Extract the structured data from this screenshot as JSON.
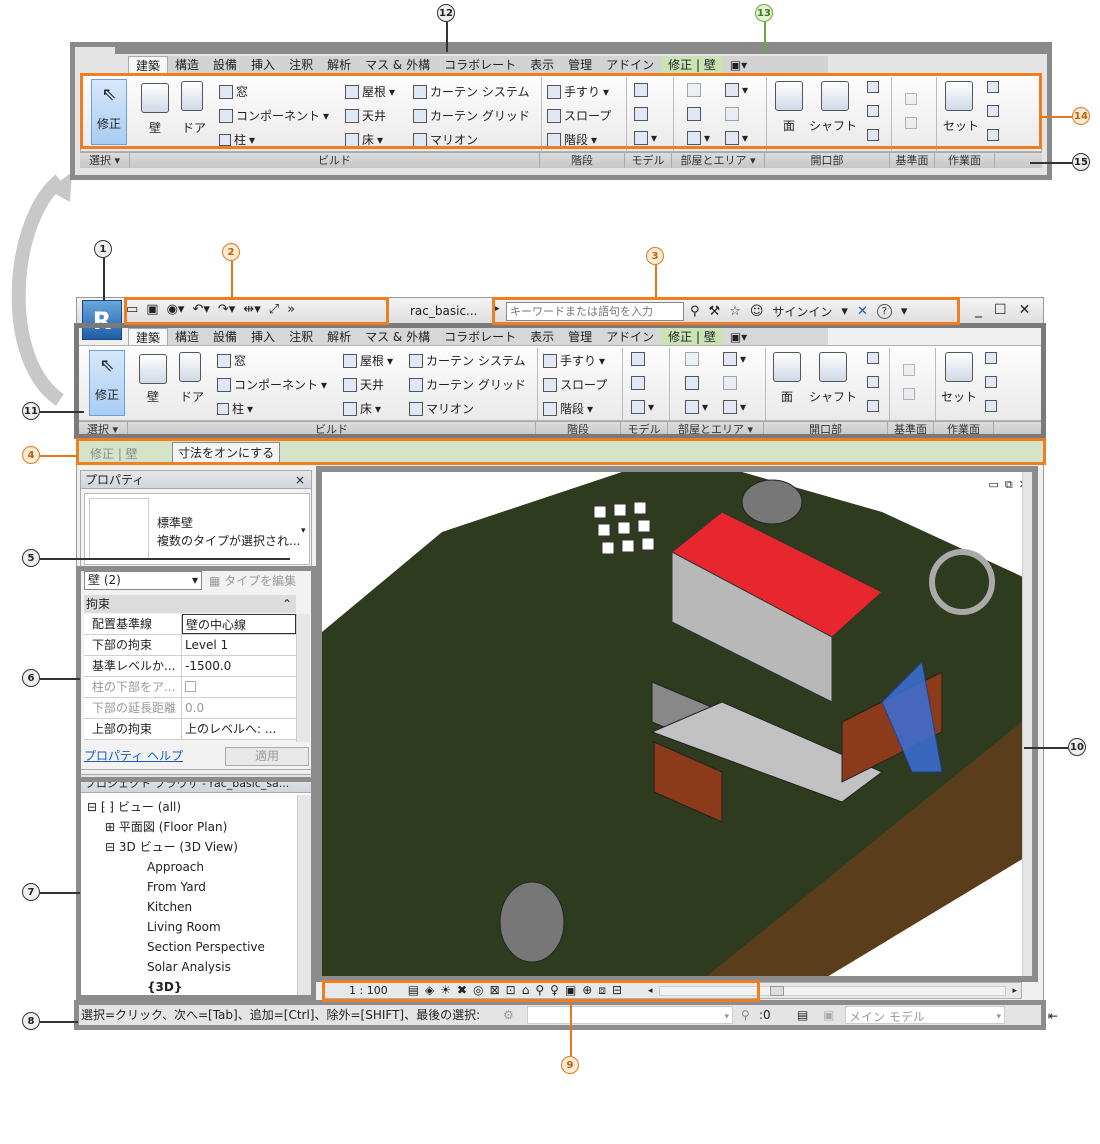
{
  "callouts": [
    "1",
    "2",
    "3",
    "4",
    "5",
    "6",
    "7",
    "8",
    "9",
    "10",
    "11",
    "12",
    "13",
    "14",
    "15"
  ],
  "tabs": [
    "建築",
    "構造",
    "設備",
    "挿入",
    "注釈",
    "解析",
    "マス & 外構",
    "コラボレート",
    "表示",
    "管理",
    "アドイン",
    "修正 | 壁",
    "▣▾"
  ],
  "ribbon": {
    "select": "修正",
    "wall": "壁",
    "door": "ドア",
    "window": "窓",
    "component": "コンポーネント",
    "column": "柱",
    "roof": "屋根",
    "ceiling": "天井",
    "floor": "床",
    "curtain_system": "カーテン システム",
    "curtain_grid": "カーテン グリッド",
    "mullion": "マリオン",
    "railing": "手すり",
    "ramp": "スロープ",
    "stair": "階段",
    "face": "面",
    "shaft": "シャフト",
    "set": "セット",
    "panels": [
      "選択 ▾",
      "ビルド",
      "階段",
      "モデル",
      "部屋とエリア ▾",
      "開口部",
      "基準面",
      "作業面"
    ]
  },
  "qat": {
    "title": "rac_basic...",
    "search_placeholder": "キーワードまたは語句を入力",
    "signin": "サインイン",
    "help": "?"
  },
  "options_bar": {
    "context": "修正 | 壁",
    "checkbox": "寸法をオンにする"
  },
  "properties": {
    "title": "プロパティ",
    "close": "×",
    "type_name": "標準壁",
    "type_sub": "複数のタイプが選択され...",
    "filter": "壁 (2)",
    "edit_type": "タイプを編集",
    "group": "拘束",
    "rows": [
      {
        "k": "配置基準線",
        "v": "壁の中心線",
        "dis": false
      },
      {
        "k": "下部の拘束",
        "v": "Level 1",
        "dis": false
      },
      {
        "k": "基準レベルか...",
        "v": "-1500.0",
        "dis": false
      },
      {
        "k": "柱の下部をア...",
        "v": "",
        "dis": true
      },
      {
        "k": "下部の延長距離",
        "v": "0.0",
        "dis": true
      },
      {
        "k": "上部の拘束",
        "v": "上のレベルへ: ...",
        "dis": false
      }
    ],
    "help": "プロパティ ヘルプ",
    "apply": "適用"
  },
  "browser": {
    "title": "プロジェクト ブラウザ - rac_basic_sa...",
    "items": [
      {
        "t": "ビュー (all)",
        "i": 0
      },
      {
        "t": "平面図 (Floor Plan)",
        "i": 1
      },
      {
        "t": "3D ビュー (3D View)",
        "i": 1
      },
      {
        "t": "Approach",
        "i": 2
      },
      {
        "t": "From Yard",
        "i": 2
      },
      {
        "t": "Kitchen",
        "i": 2
      },
      {
        "t": "Living Room",
        "i": 2
      },
      {
        "t": "Section Perspective",
        "i": 2
      },
      {
        "t": "Solar Analysis",
        "i": 2
      },
      {
        "t": "{3D}",
        "i": 2
      }
    ]
  },
  "view": {
    "scale": "1 : 100"
  },
  "statusbar": {
    "text": "選択=クリック、次へ=[Tab]、追加=[Ctrl]、除外=[SHIFT]、最後の選択:",
    "count": ":0",
    "model": "メイン モデル"
  }
}
